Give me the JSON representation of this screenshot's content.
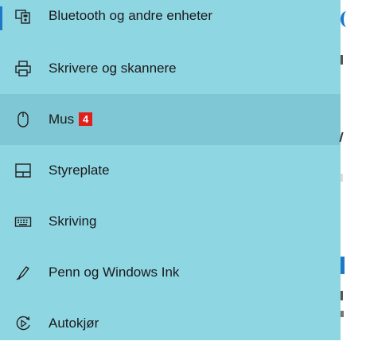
{
  "sidebar": {
    "items": [
      {
        "label": "Bluetooth og andre enheter",
        "icon": "bluetooth-devices-icon"
      },
      {
        "label": "Skrivere og skannere",
        "icon": "printer-icon"
      },
      {
        "label": "Mus",
        "icon": "mouse-icon",
        "badge": "4"
      },
      {
        "label": "Styreplate",
        "icon": "touchpad-icon"
      },
      {
        "label": "Skriving",
        "icon": "keyboard-icon"
      },
      {
        "label": "Penn og Windows Ink",
        "icon": "pen-icon"
      },
      {
        "label": "Autokjør",
        "icon": "autoplay-icon"
      }
    ]
  },
  "colors": {
    "sidebar_bg": "#8fd6e3",
    "selected_bg": "#7fc7d4",
    "accent": "#1d78c8",
    "badge_bg": "#e0211b"
  }
}
